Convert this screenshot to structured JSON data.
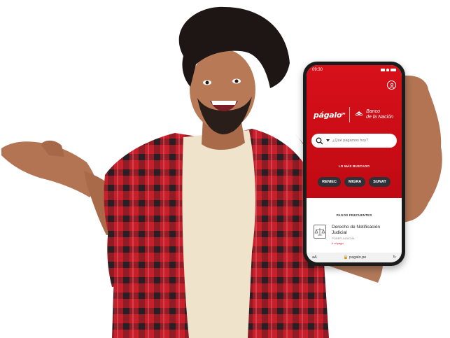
{
  "phone": {
    "time": "09:30",
    "brand": "págalo",
    "brand_suffix": "pe",
    "partner_line1": "Banco",
    "partner_line2": "de la Nación",
    "search_placeholder": "¿Qué pagamos hoy?",
    "most_searched_label": "LO MÁS BUSCADO",
    "chips": [
      "RENIEC",
      "MIGRA",
      "SUNAT"
    ],
    "frequent_label": "PAGOS FRECUENTES",
    "frequent_item": {
      "title": "Derecho de Notificación Judicial",
      "subtitle": "PODER JUDICIAL",
      "tag": "Ir al pago"
    },
    "url_text_size": "aA",
    "url": "pagalo.pe"
  },
  "colors": {
    "brand_red": "#d8101a",
    "shirt_red": "#c8202a",
    "shirt_dark": "#2a1f24"
  }
}
